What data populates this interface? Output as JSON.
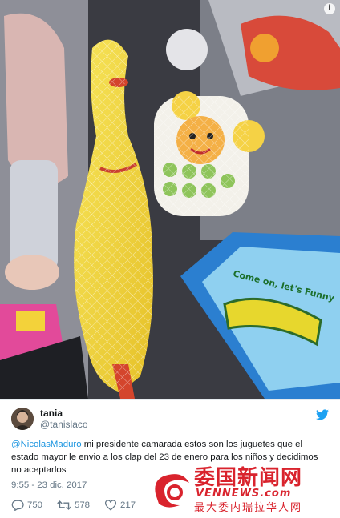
{
  "photo": {
    "info_glyph": "i",
    "box_text": "Come on, let's Funny"
  },
  "tweet": {
    "display_name": "tania",
    "handle": "@tanislaco",
    "mention": "@NicolasMaduro",
    "body": " mi presidente camarada estos son los juguetes que el estado mayor le envio a los clap del 23 de enero para los niños y decidimos no aceptarlos",
    "timestamp": "9:55 - 23 dic. 2017",
    "replies": "750",
    "retweets": "578",
    "likes": "217",
    "icons": {
      "brand": "twitter-bird-icon",
      "reply": "reply-icon",
      "retweet": "retweet-icon",
      "like": "heart-icon"
    },
    "colors": {
      "link": "#1b95e0",
      "muted": "#657786",
      "brand": "#1da1f2"
    }
  },
  "watermark": {
    "title": "委国新闻网",
    "url": "VENNEWS.com",
    "subtitle": "最大委内瑞拉华人网",
    "color": "#d9232d"
  }
}
